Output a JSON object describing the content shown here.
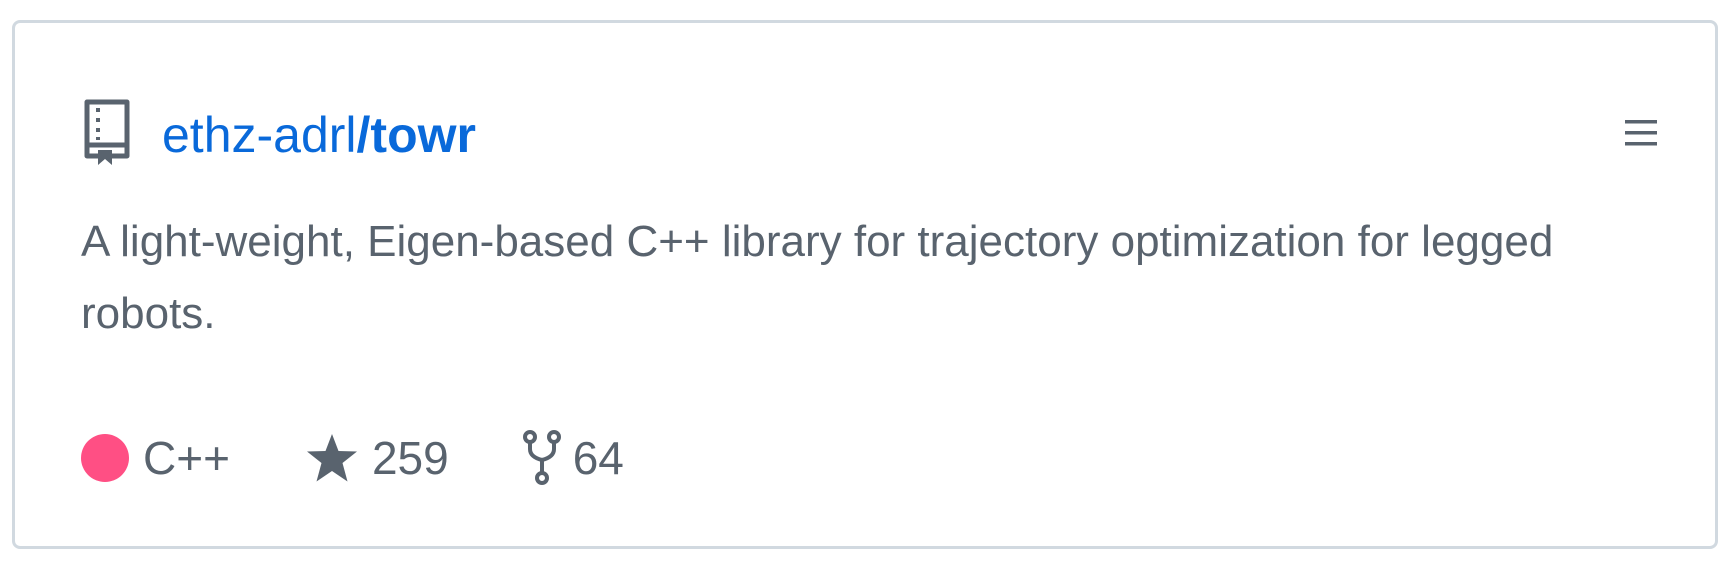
{
  "repo": {
    "owner": "ethz-adrl",
    "name": "/towr",
    "description": "A light-weight, Eigen-based C++ library for trajectory optimization for legged robots."
  },
  "meta": {
    "language": "C++",
    "language_color": "#ff4f84",
    "stars": "259",
    "forks": "64"
  },
  "icons": {
    "repo": "repo-book-icon",
    "menu": "hamburger-menu-icon",
    "star": "star-icon",
    "fork": "fork-icon"
  },
  "colors": {
    "link": "#0969da",
    "muted": "#59636e",
    "border": "#d1d9e0"
  }
}
